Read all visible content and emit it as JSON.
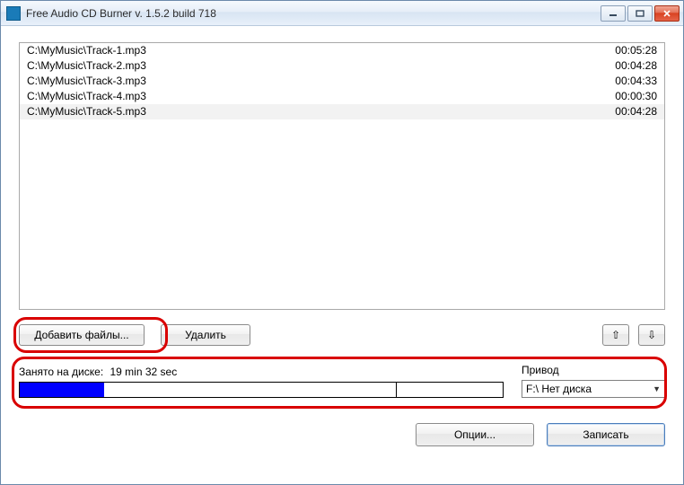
{
  "window": {
    "title": "Free Audio CD Burner  v. 1.5.2 build 718"
  },
  "tracks": [
    {
      "path": "C:\\MyMusic\\Track-1.mp3",
      "duration": "00:05:28",
      "selected": false
    },
    {
      "path": "C:\\MyMusic\\Track-2.mp3",
      "duration": "00:04:28",
      "selected": false
    },
    {
      "path": "C:\\MyMusic\\Track-3.mp3",
      "duration": "00:04:33",
      "selected": false
    },
    {
      "path": "C:\\MyMusic\\Track-4.mp3",
      "duration": "00:00:30",
      "selected": false
    },
    {
      "path": "C:\\MyMusic\\Track-5.mp3",
      "duration": "00:04:28",
      "selected": true
    }
  ],
  "buttons": {
    "add_files": "Добавить файлы...",
    "delete": "Удалить",
    "options": "Опции...",
    "burn": "Записать"
  },
  "arrows": {
    "up": "⇧",
    "down": "⇩"
  },
  "disk": {
    "label": "Занято на диске:",
    "value": "19 min 32 sec",
    "fill_percent": 17.5,
    "ticks": [
      78
    ]
  },
  "drive": {
    "label": "Привод",
    "selected": "F:\\ Нет диска"
  }
}
